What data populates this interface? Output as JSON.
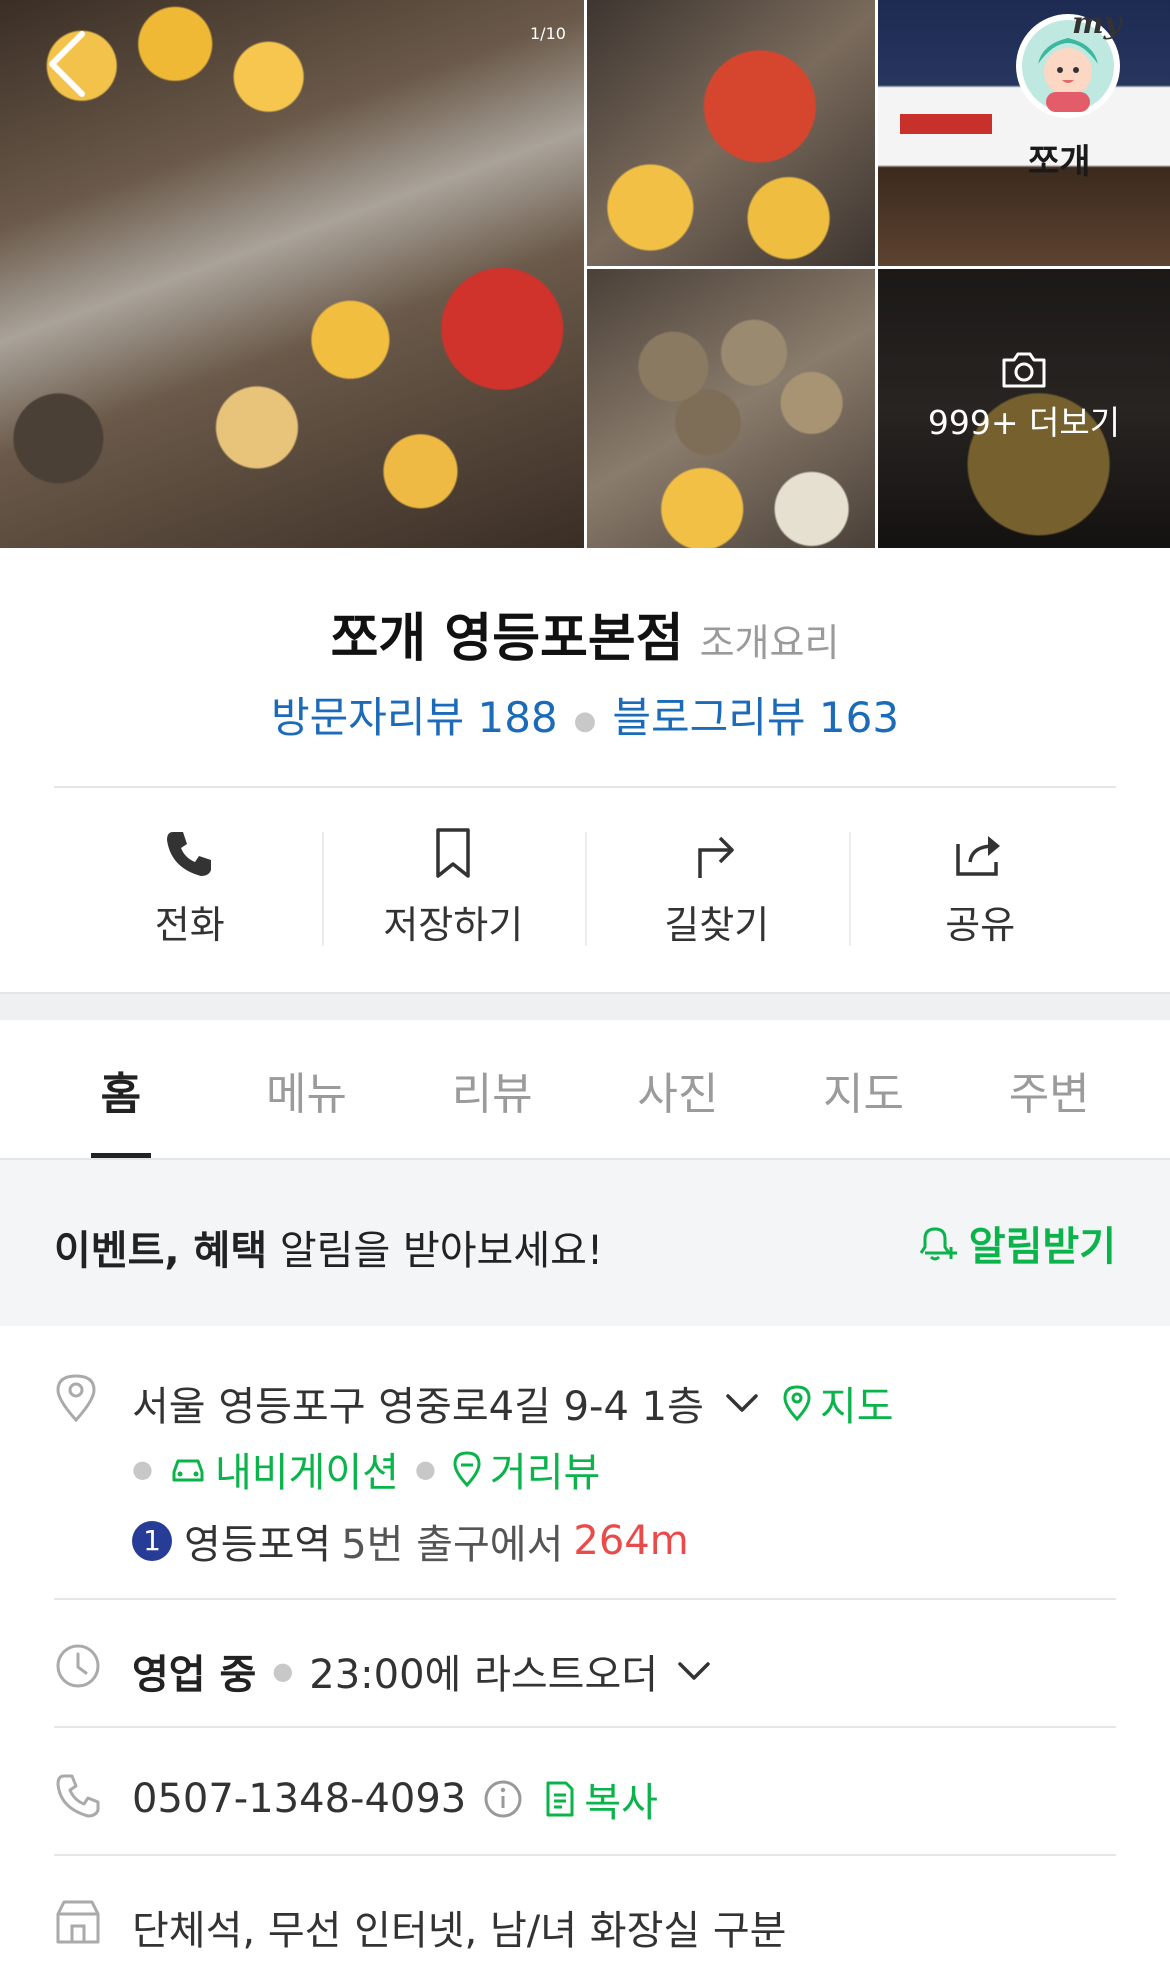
{
  "gallery": {
    "counter": "1/10",
    "more_label": "999+ 더보기",
    "my_badge": "my",
    "sign_text": "쪼개"
  },
  "place": {
    "name": "쪼개 영등포본점",
    "category": "조개요리",
    "visitor_reviews": "방문자리뷰 188",
    "blog_reviews": "블로그리뷰 163"
  },
  "actions": [
    {
      "label": "전화",
      "icon": "phone-icon"
    },
    {
      "label": "저장하기",
      "icon": "bookmark-icon"
    },
    {
      "label": "길찾기",
      "icon": "directions-icon"
    },
    {
      "label": "공유",
      "icon": "share-icon"
    }
  ],
  "tabs": [
    "홈",
    "메뉴",
    "리뷰",
    "사진",
    "지도",
    "주변"
  ],
  "active_tab": "홈",
  "notify": {
    "bold_text": "이벤트, 혜택",
    "text": " 알림을 받아보세요!",
    "button": "알림받기"
  },
  "address": {
    "text": "서울 영등포구 영중로4길 9-4 1층",
    "map_link": "지도",
    "navigation": "내비게이션",
    "street_view": "거리뷰"
  },
  "subway": {
    "line": "1",
    "station": "영등포역",
    "exit": "5번 출구에서",
    "distance": "264m"
  },
  "hours": {
    "status": "영업 중",
    "detail": "23:00에 라스트오더"
  },
  "phone": {
    "number": "0507-1348-4093",
    "copy": "복사"
  },
  "amenities": "단체석, 무선 인터넷, 남/녀 화장실 구분",
  "colors": {
    "green": "#0bb34b",
    "blue": "#1b6bb8",
    "red": "#e94b4b",
    "subway_line1": "#263c96"
  }
}
